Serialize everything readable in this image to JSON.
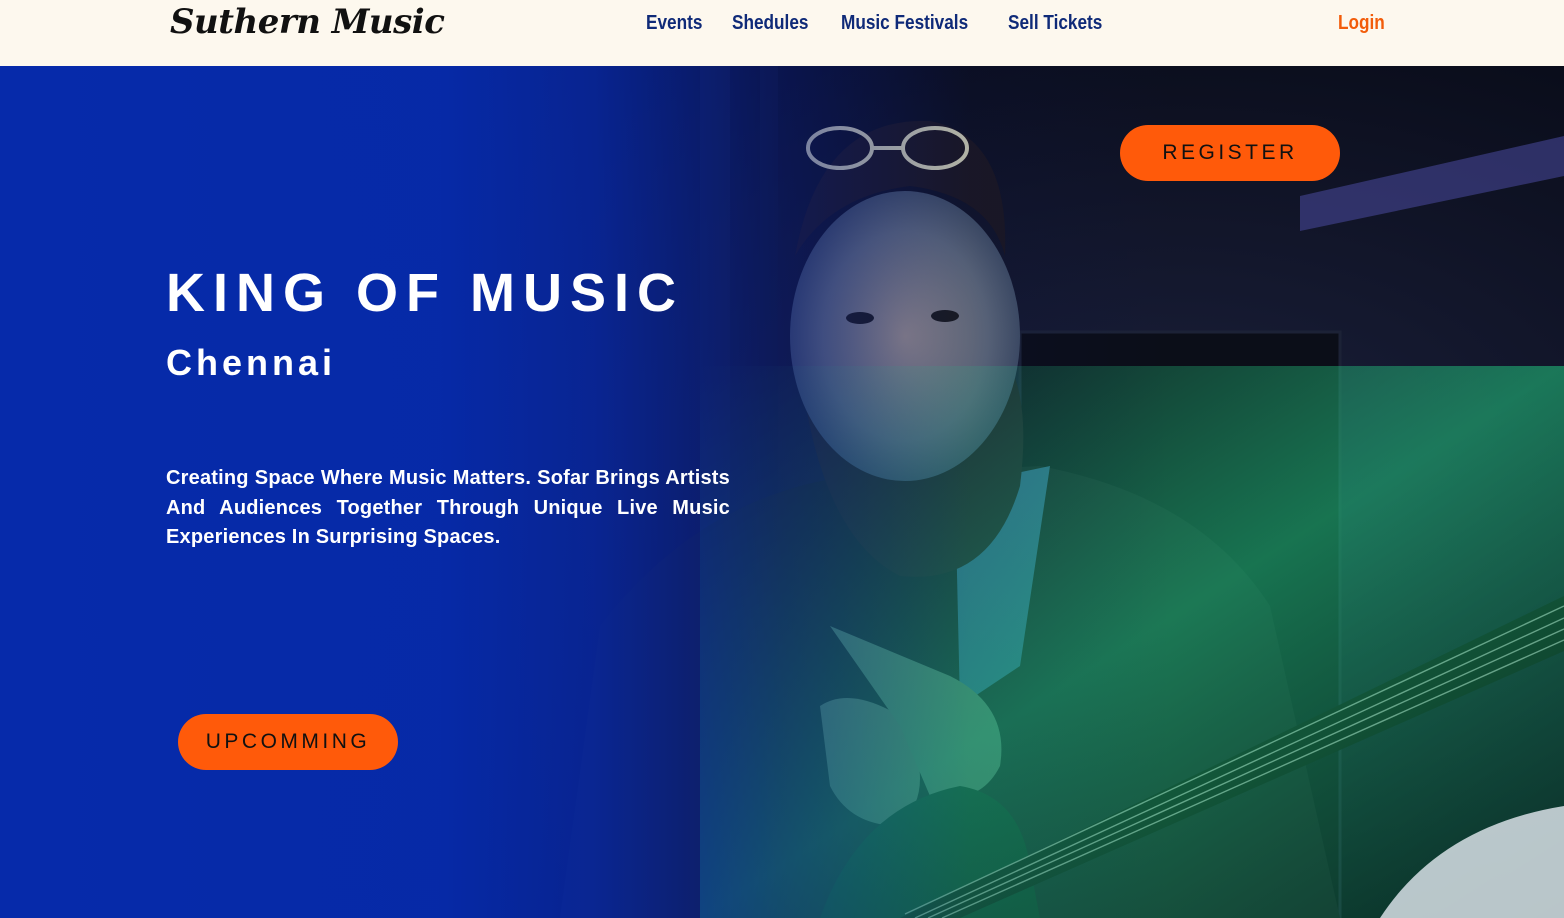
{
  "header": {
    "logo_text": "Suthern Music",
    "nav": [
      {
        "label": "Events"
      },
      {
        "label": "Shedules"
      },
      {
        "label": "Music Festivals"
      },
      {
        "label": "Sell Tickets"
      }
    ],
    "login_label": "Login"
  },
  "hero": {
    "title": "KING OF MUSIC",
    "subtitle": "Chennai",
    "description": "Creating Space Where Music Matters. Sofar Brings Artists And Audiences Together Through Unique Live Music Experiences In Surprising Spaces.",
    "register_label": "REGISTER",
    "upcoming_label": "UPCOMMING",
    "image_description": "Bearded musician with sunglasses on head holding a bass guitar, lit by green stage light"
  },
  "colors": {
    "background": "#fdf8ee",
    "nav_link": "#0f2a78",
    "accent": "#ff5a0a",
    "hero_blue": "#062aaa"
  }
}
